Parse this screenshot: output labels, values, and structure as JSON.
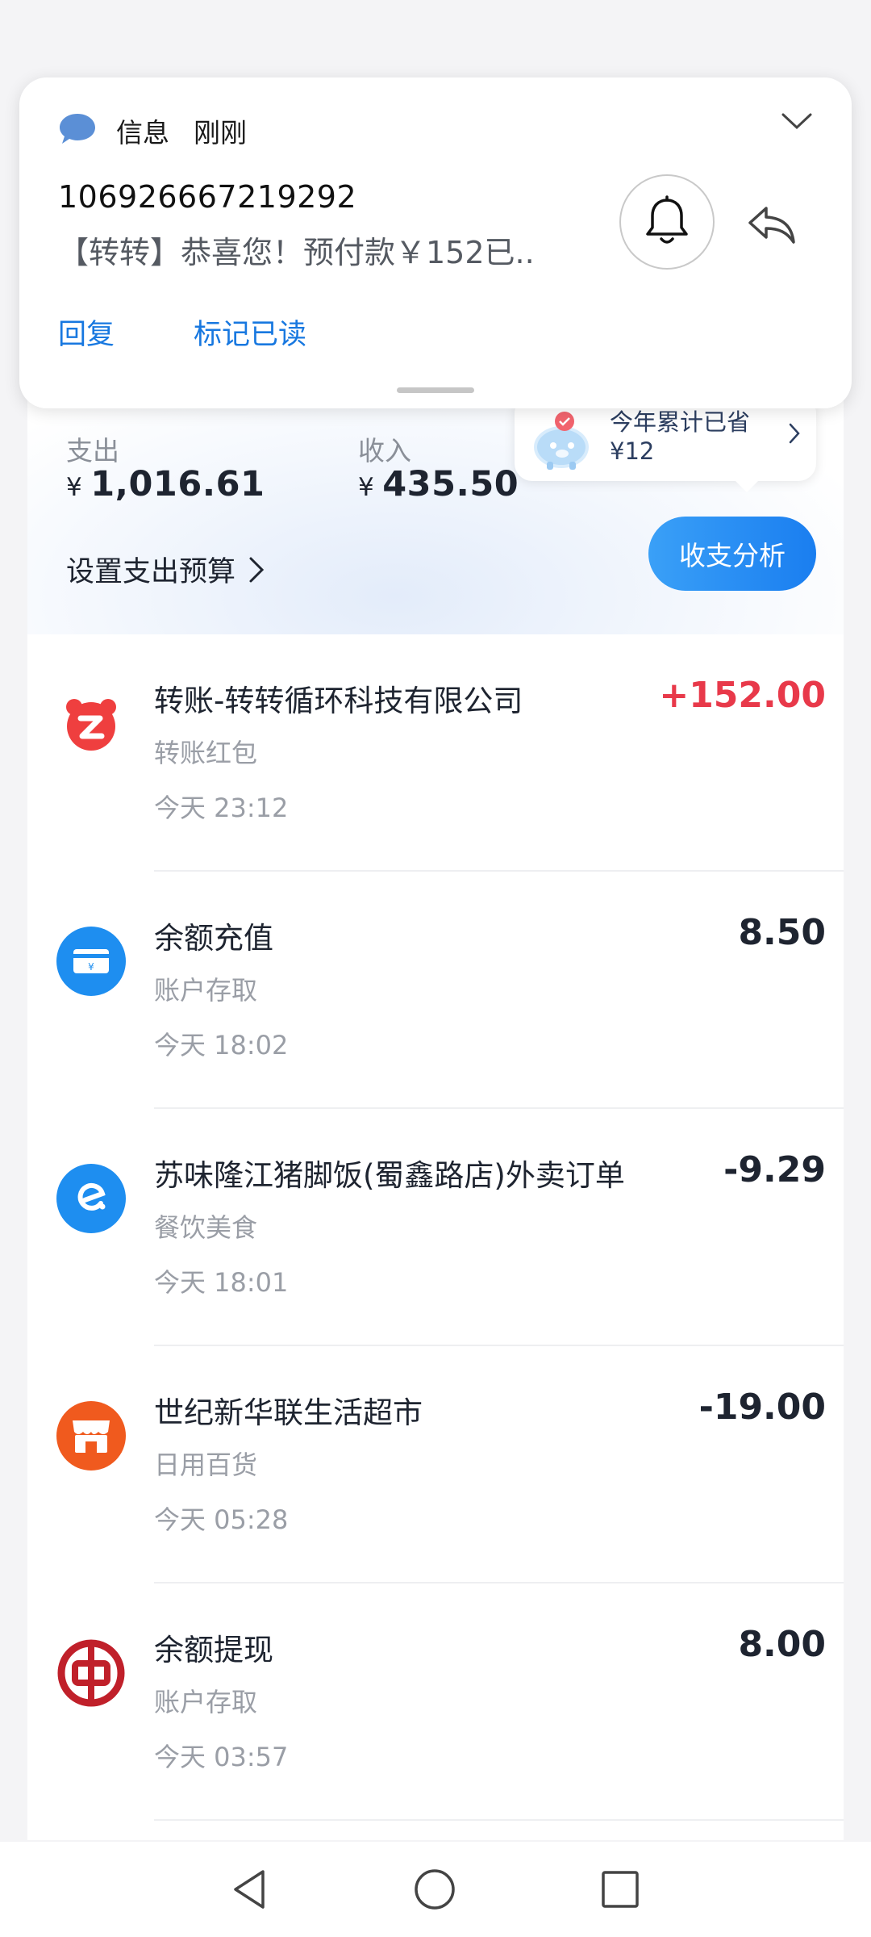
{
  "notification": {
    "app_name": "信息",
    "time": "刚刚",
    "sender": "106926667219292",
    "body": "【转转】恭喜您！预付款￥152已..",
    "actions": {
      "reply": "回复",
      "mark_read": "标记已读"
    }
  },
  "summary": {
    "expense_label": "支出",
    "expense_currency": "¥",
    "expense_value": "1,016.61",
    "income_label": "收入",
    "income_currency": "¥",
    "income_value": "435.50",
    "budget_link": "设置支出预算",
    "analysis_button": "收支分析",
    "savings": {
      "title": "今年累计已省",
      "amount": "¥12"
    }
  },
  "transactions": [
    {
      "title": "转账-转转循环科技有限公司",
      "category": "转账红包",
      "time": "今天 23:12",
      "amount": "+152.00",
      "icon": "zhuanzhuan-icon",
      "color": "#ef3f3f"
    },
    {
      "title": "余额充值",
      "category": "账户存取",
      "time": "今天 18:02",
      "amount": "8.50",
      "icon": "balance-card-icon",
      "color": "#1e8ef0"
    },
    {
      "title": "苏味隆江猪脚饭(蜀鑫路店)外卖订单",
      "category": "餐饮美食",
      "time": "今天 18:01",
      "amount": "-9.29",
      "icon": "eleme-icon",
      "color": "#1e8ef0"
    },
    {
      "title": "世纪新华联生活超市",
      "category": "日用百货",
      "time": "今天 05:28",
      "amount": "-19.00",
      "icon": "shop-icon",
      "color": "#f05a1e"
    },
    {
      "title": "余额提现",
      "category": "账户存取",
      "time": "今天 03:57",
      "amount": "8.00",
      "icon": "bank-of-china-icon",
      "color": "#c0202a"
    }
  ],
  "navbar": {
    "back": "back-icon",
    "home": "home-icon",
    "recents": "recents-icon"
  },
  "colors": {
    "accent": "#1a7ef0",
    "income": "#e8394a",
    "link": "#1878e0"
  }
}
